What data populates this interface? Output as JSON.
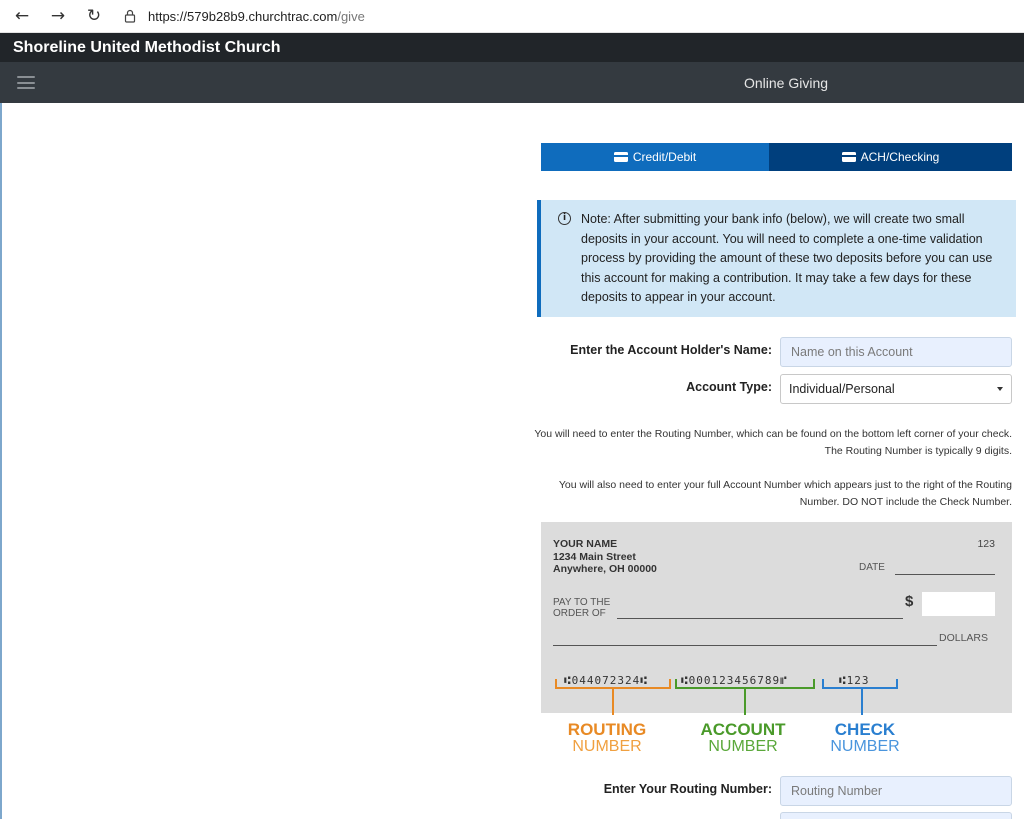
{
  "browser": {
    "url_host": "https://579b28b9.churchtrac.com",
    "url_path": "/give"
  },
  "site": {
    "title": "Shoreline United Methodist Church",
    "nav_title": "Online Giving"
  },
  "tabs": [
    {
      "label": "Credit/Debit",
      "active": true,
      "color": "#0f6cbd"
    },
    {
      "label": "ACH/Checking",
      "active": false,
      "color": "#003f7d"
    }
  ],
  "note": {
    "text": "Note: After submitting your bank info (below), we will create two small deposits in your account. You will need to complete a one-time validation process by providing the amount of these two deposits before you can use this account for making a contribution. It may take a few days for these deposits to appear in your account."
  },
  "form": {
    "holder_label": "Enter the Account Holder's Name:",
    "holder_placeholder": "Name on this Account",
    "type_label": "Account Type:",
    "type_value": "Individual/Personal",
    "routing_help": "You will need to enter the Routing Number, which can be found on the bottom left corner of your check. The Routing Number is typically 9 digits.",
    "account_help": "You will also need to enter your full Account Number which appears just to the right of the Routing Number. DO NOT include the Check Number.",
    "routing_label": "Enter Your Routing Number:",
    "routing_placeholder": "Routing Number"
  },
  "check": {
    "name": "YOUR NAME",
    "street": "1234 Main Street",
    "city": "Anywhere, OH 00000",
    "number": "123",
    "date_label": "DATE",
    "pay_line1": "PAY TO THE",
    "pay_line2": "ORDER OF",
    "dollar_sign": "$",
    "dollars_label": "DOLLARS",
    "micr_routing": "⑆044072324⑆",
    "micr_account": "⑆000123456789⑈",
    "micr_check": "⑆123",
    "routing_big": "ROUTING",
    "routing_small": "NUMBER",
    "account_big": "ACCOUNT",
    "account_small": "NUMBER",
    "check_big": "CHECK",
    "check_small": "NUMBER"
  }
}
